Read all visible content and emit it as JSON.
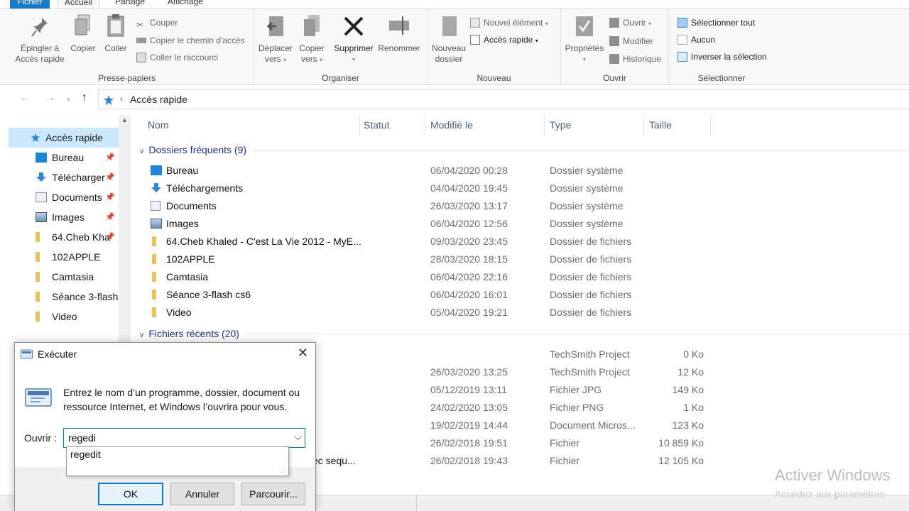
{
  "ribbon": {
    "tabs": [
      "Fichier",
      "Accueil",
      "Partage",
      "Affichage"
    ],
    "presse_papiers": {
      "group_label": "Presse-papiers",
      "pin_label_1": "Épingler à",
      "pin_label_2": "Accès rapide",
      "copy": "Copier",
      "paste": "Coller",
      "cut": "Couper",
      "copy_path": "Copier le chemin d'accès",
      "paste_shortcut": "Coller le raccourci"
    },
    "organiser": {
      "group_label": "Organiser",
      "move_1": "Déplacer",
      "move_2": "vers",
      "copyto_1": "Copier",
      "copyto_2": "vers",
      "delete": "Supprimer",
      "rename": "Renommer"
    },
    "nouveau": {
      "group_label": "Nouveau",
      "new_folder_1": "Nouveau",
      "new_folder_2": "dossier",
      "new_item": "Nouvel élément",
      "quick_access": "Accès rapide"
    },
    "ouvrir": {
      "group_label": "Ouvrir",
      "properties": "Propriétés",
      "open": "Ouvrir",
      "edit": "Modifier",
      "history": "Historique"
    },
    "selectionner": {
      "group_label": "Sélectionner",
      "select_all": "Sélectionner tout",
      "select_none": "Aucun",
      "invert": "Inverser la sélection"
    }
  },
  "address": {
    "location": "Accès rapide"
  },
  "sidebar": {
    "items": [
      {
        "label": "Accès rapide",
        "icon": "star-icon"
      },
      {
        "label": "Bureau",
        "icon": "desktop-icon"
      },
      {
        "label": "Télécharger",
        "icon": "download-icon"
      },
      {
        "label": "Documents",
        "icon": "document-icon"
      },
      {
        "label": "Images",
        "icon": "image-icon"
      },
      {
        "label": "64.Cheb Kha",
        "icon": "folder-icon"
      },
      {
        "label": "102APPLE",
        "icon": "folder-icon"
      },
      {
        "label": "Camtasia",
        "icon": "folder-icon"
      },
      {
        "label": "Séance 3-flash",
        "icon": "folder-icon"
      },
      {
        "label": "Video",
        "icon": "folder-icon"
      }
    ]
  },
  "columns": [
    "Nom",
    "Statut",
    "Modifié le",
    "Type",
    "Taille"
  ],
  "frequent": {
    "header": "Dossiers fréquents (9)",
    "rows": [
      {
        "name": "Bureau",
        "date": "06/04/2020 00:28",
        "type": "Dossier système",
        "icon": "desktop-icon"
      },
      {
        "name": "Téléchargements",
        "date": "04/04/2020 19:45",
        "type": "Dossier système",
        "icon": "download-icon"
      },
      {
        "name": "Documents",
        "date": "26/03/2020 13:17",
        "type": "Dossier système",
        "icon": "document-icon"
      },
      {
        "name": "Images",
        "date": "06/04/2020 12:56",
        "type": "Dossier système",
        "icon": "image-icon"
      },
      {
        "name": "64.Cheb Khaled - C'est La Vie 2012 - MyE...",
        "date": "09/03/2020 23:45",
        "type": "Dossier de fichiers",
        "icon": "folder-icon"
      },
      {
        "name": "102APPLE",
        "date": "28/03/2020 18:15",
        "type": "Dossier de fichiers",
        "icon": "folder-icon"
      },
      {
        "name": "Camtasia",
        "date": "06/04/2020 22:16",
        "type": "Dossier de fichiers",
        "icon": "folder-icon"
      },
      {
        "name": "Séance 3-flash cs6",
        "date": "06/04/2020 16:01",
        "type": "Dossier de fichiers",
        "icon": "folder-icon"
      },
      {
        "name": "Video",
        "date": "05/04/2020 19:21",
        "type": "Dossier de fichiers",
        "icon": "folder-icon"
      }
    ]
  },
  "recent": {
    "header": "Fichiers récents (20)",
    "rows": [
      {
        "name": "",
        "date": "",
        "type": "TechSmith Project",
        "size": "0 Ko"
      },
      {
        "name": "",
        "date": "26/03/2020 13:25",
        "type": "TechSmith Project",
        "size": "12 Ko"
      },
      {
        "name": "",
        "date": "05/12/2019 13:11",
        "type": "Fichier JPG",
        "size": "149 Ko"
      },
      {
        "name": "",
        "date": "24/02/2020 13:05",
        "type": "Fichier PNG",
        "size": "1 Ko"
      },
      {
        "name": "",
        "date": "19/02/2019 14:44",
        "type": "Document Micros...",
        "size": "123 Ko"
      },
      {
        "name": "",
        "date": "26/02/2018 19:51",
        "type": "Fichier",
        "size": "10 859 Ko"
      },
      {
        "name": "ec sequ...",
        "date": "26/02/2018 19:43",
        "type": "Fichier",
        "size": "12 105 Ko"
      }
    ]
  },
  "watermark": {
    "line1": "Activer Windows",
    "line2": "Accédez aux paramètres"
  },
  "run_dialog": {
    "title": "Exécuter",
    "description": "Entrez le nom d’un programme, dossier, document ou ressource Internet, et Windows l’ouvrira pour vous.",
    "open_label": "Ouvrir :",
    "input_value": "regedi",
    "suggestion": "regedit",
    "ok": "OK",
    "cancel": "Annuler",
    "browse": "Parcourir..."
  },
  "colors": {
    "accent": "#0078d7",
    "file_tab": "#1979ca",
    "group_header": "#1e3287",
    "folder": "#e8c25c",
    "selected": "#cce8ff"
  }
}
